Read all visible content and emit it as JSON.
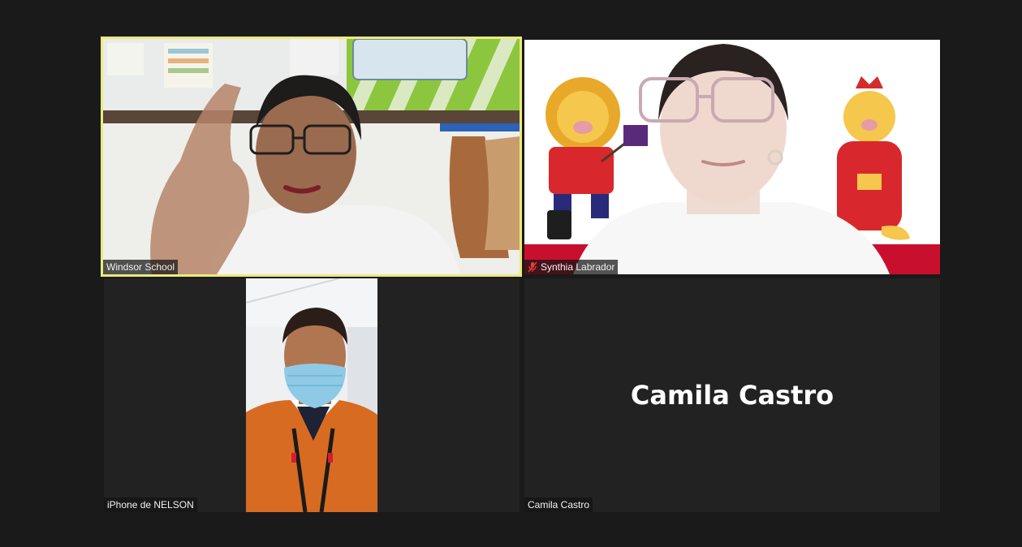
{
  "app": {
    "accent_active_border": "#ecea7c",
    "background": "#1a1a1a",
    "tile_background": "#222222"
  },
  "participants": [
    {
      "name": "Windsor School",
      "active_speaker": true,
      "video_on": true,
      "muted": false
    },
    {
      "name": "Synthia Labrador",
      "active_speaker": false,
      "video_on": true,
      "muted": true,
      "status_icon": "mic-muted-icon"
    },
    {
      "name": "iPhone de NELSON",
      "active_speaker": false,
      "video_on": true,
      "muted": false
    },
    {
      "name": "Camila Castro",
      "active_speaker": false,
      "video_on": false,
      "muted": false
    }
  ]
}
